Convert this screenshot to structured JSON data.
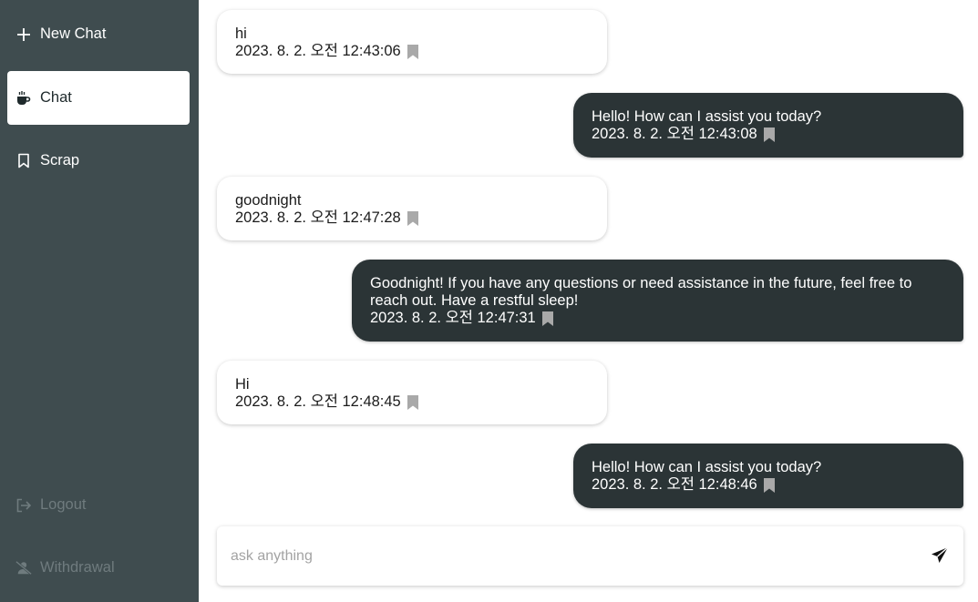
{
  "sidebar": {
    "new_chat": "New Chat",
    "chat": "Chat",
    "scrap": "Scrap",
    "logout": "Logout",
    "withdrawal": "Withdrawal"
  },
  "messages": [
    {
      "role": "user",
      "text": "hi",
      "time": "2023. 8. 2. 오전 12:43:06"
    },
    {
      "role": "bot",
      "text": "Hello! How can I assist you today?",
      "time": "2023. 8. 2. 오전 12:43:08"
    },
    {
      "role": "user",
      "text": "goodnight",
      "time": "2023. 8. 2. 오전 12:47:28"
    },
    {
      "role": "bot",
      "text_line1": "Goodnight! If you have any questions or need assistance in the future, feel free to",
      "text_line2": "reach out. Have a restful sleep!",
      "time": "2023. 8. 2. 오전 12:47:31"
    },
    {
      "role": "user",
      "text": "Hi",
      "time": "2023. 8. 2. 오전 12:48:45"
    },
    {
      "role": "bot",
      "text": "Hello! How can I assist you today?",
      "time": "2023. 8. 2. 오전 12:48:46"
    }
  ],
  "composer": {
    "placeholder": "ask anything"
  },
  "colors": {
    "sidebar": "#3f4c4f",
    "bot_bubble": "#2b3436",
    "bookmark": "#a9a9a9"
  }
}
